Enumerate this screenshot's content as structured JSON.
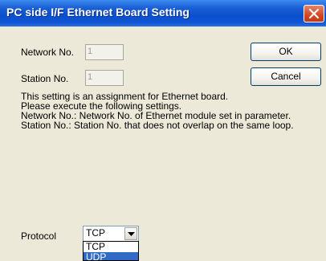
{
  "window": {
    "title": "PC side I/F Ethernet Board Setting"
  },
  "form": {
    "network_label": "Network No.",
    "network_value": "1",
    "station_label": "Station No.",
    "station_value": "1"
  },
  "buttons": {
    "ok_label": "OK",
    "cancel_label": "Cancel"
  },
  "info_lines": [
    "This setting is an assignment for Ethernet board.",
    "Please execute the following settings.",
    "Network No.: Network No. of Ethernet module set in parameter.",
    "Station No.: Station No. that does not overlap on the same loop."
  ],
  "protocol": {
    "label": "Protocol",
    "selected": "TCP",
    "options": [
      "TCP",
      "UDP"
    ],
    "highlighted": "UDP"
  },
  "colors": {
    "titlebar": "#0b4fcc",
    "close": "#d6461f",
    "highlight": "#316ac5"
  }
}
